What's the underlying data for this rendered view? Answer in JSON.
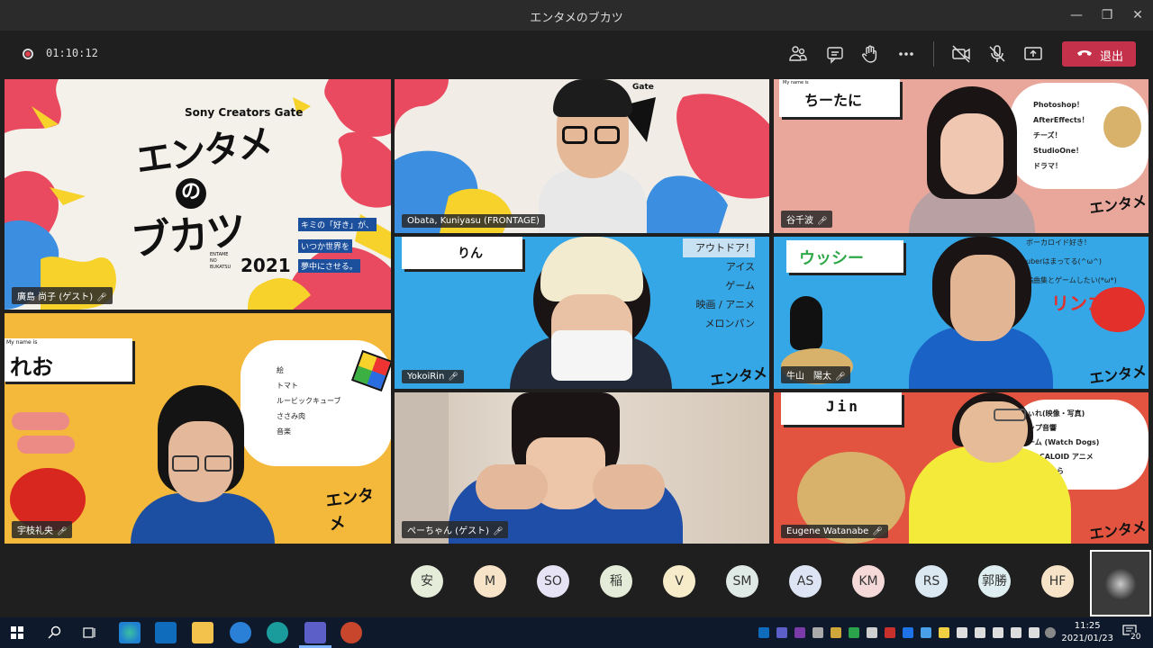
{
  "window": {
    "title": "エンタメのブカツ",
    "minimize": "—",
    "restore": "❐",
    "close": "✕"
  },
  "meeting": {
    "elapsed": "01:10:12",
    "leave_label": "退出"
  },
  "tiles": [
    {
      "id": "t1",
      "name": "廣島 尚子 (ゲスト)",
      "mic": "🎤︎"
    },
    {
      "id": "t2",
      "name": "Obata, Kuniyasu (FRONTAGE)",
      "mic": ""
    },
    {
      "id": "t3",
      "name": "谷千波",
      "mic": "🎤︎"
    },
    {
      "id": "t4",
      "name": "宇枝礼央",
      "mic": "🎤︎"
    },
    {
      "id": "t5",
      "name": "YokoiRin",
      "mic": "🎤︎"
    },
    {
      "id": "t6",
      "name": "牛山　陽太",
      "mic": "🎤︎"
    },
    {
      "id": "t7",
      "name": "ぺーちゃん (ゲスト)",
      "mic": "🎤︎"
    },
    {
      "id": "t8",
      "name": "Eugene Watanabe",
      "mic": "🎤︎"
    }
  ],
  "banner": {
    "brand": "Sony Creators Gate",
    "logo_line1": "エンタメ",
    "logo_line2": "ブカツ",
    "logo_no": "の",
    "year": "2021",
    "sub_en": "ENTAME NO BUKATSU",
    "tagline": [
      "キミの「好き」が、",
      "いつか世界を",
      "夢中にさせる。"
    ]
  },
  "t2_text": "Gate",
  "t3": {
    "my_name": "My name is",
    "nickname": "ちーたに",
    "likes": [
      "Photoshop！",
      "AfterEffects！",
      "チーズ！",
      "StudioOne！",
      "ドラマ！"
    ]
  },
  "t4": {
    "my_name": "My name is",
    "nickname": "れお",
    "likes": [
      "絵",
      "トマト",
      "ルービックキューブ",
      "ささみ肉",
      "音楽"
    ]
  },
  "t5": {
    "nickname": "りん",
    "likes": [
      "アウトドア！",
      "アイス",
      "ゲーム",
      "映画 / アニメ",
      "メロンパン"
    ]
  },
  "t6": {
    "nickname": "ウッシー",
    "likes": [
      "ボーカロイド好き！",
      "uberはまってる(^ω^)",
      "編曲集とゲームしたい(*ω*)"
    ],
    "sticker": "リンゴ"
  },
  "t8": {
    "nickname": "Jin",
    "likes": [
      "ぃれ(映像・写真)",
      "ップ音響",
      "ーム (Watch Dogs)",
      "VOCALOID アニメ",
      "ぐゃが乃ら"
    ]
  },
  "roster": [
    {
      "label": "安",
      "color": "#e5ecd9"
    },
    {
      "label": "M",
      "color": "#f7e4c8"
    },
    {
      "label": "SO",
      "color": "#e6e3f5"
    },
    {
      "label": "稲",
      "color": "#e4ecd9"
    },
    {
      "label": "V",
      "color": "#f7ecc9"
    },
    {
      "label": "SM",
      "color": "#dfe9e6"
    },
    {
      "label": "AS",
      "color": "#dde4f3"
    },
    {
      "label": "KM",
      "color": "#f5d9d9"
    },
    {
      "label": "RS",
      "color": "#dbe8f1"
    },
    {
      "label": "郭勝",
      "color": "#dfeef0"
    },
    {
      "label": "HF",
      "color": "#f7e4c8"
    }
  ],
  "taskbar": {
    "time": "11:25",
    "date": "2021/01/23",
    "notification_count": "20"
  },
  "colors": {
    "leave": "#c4314b",
    "teams_bg": "#1f1f1f",
    "taskbar": "#0e1a2b"
  }
}
